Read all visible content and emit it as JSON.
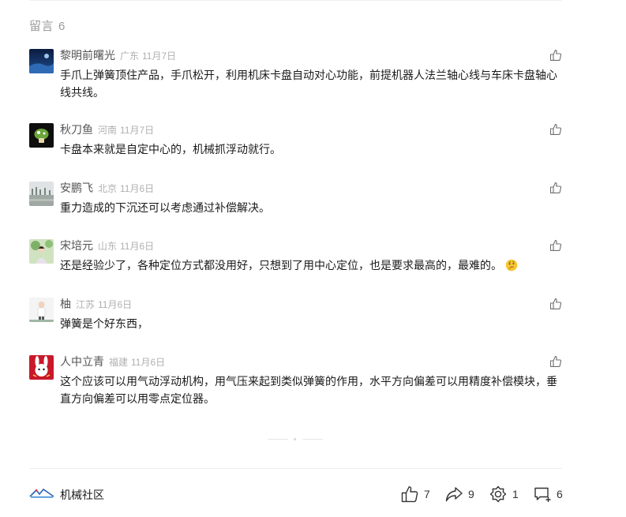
{
  "section": {
    "title": "留言",
    "count": "6"
  },
  "comments": [
    {
      "name": "黎明前曙光",
      "location": "广东",
      "date": "11月7日",
      "text": "手爪上弹簧顶住产品，手爪松开，利用机床卡盘自动对心功能，前提机器人法兰轴心线与车床卡盘轴心线共线。"
    },
    {
      "name": "秋刀鱼",
      "location": "河南",
      "date": "11月7日",
      "text": "卡盘本来就是自定中心的，机械抓浮动就行。"
    },
    {
      "name": "安鹏飞",
      "location": "北京",
      "date": "11月6日",
      "text": "重力造成的下沉还可以考虑通过补偿解决。"
    },
    {
      "name": "宋培元",
      "location": "山东",
      "date": "11月6日",
      "text": "还是经验少了，各种定位方式都没用好，只想到了用中心定位，也是要求最高的，最难的。"
    },
    {
      "name": "柚",
      "location": "江苏",
      "date": "11月6日",
      "text": "弹簧是个好东西，"
    },
    {
      "name": "人中立青",
      "location": "福建",
      "date": "11月6日",
      "text": "这个应该可以用气动浮动机构，用气压来起到类似弹簧的作用，水平方向偏差可以用精度补偿模块，垂直方向偏差可以用零点定位器。"
    }
  ],
  "footer": {
    "account_name": "机械社区",
    "likes": "7",
    "shares": "9",
    "recommends": "1",
    "comments": "6"
  },
  "icons": {
    "like": "thumbs-up-icon",
    "share": "share-arrow-icon",
    "recommend": "wow-flower-icon",
    "comment": "comment-plus-icon",
    "emoji": "thinking-face-emoji"
  },
  "colors": {
    "muted": "#9b9b9b",
    "meta": "#b0b0b0",
    "text": "#1a1a1a"
  }
}
